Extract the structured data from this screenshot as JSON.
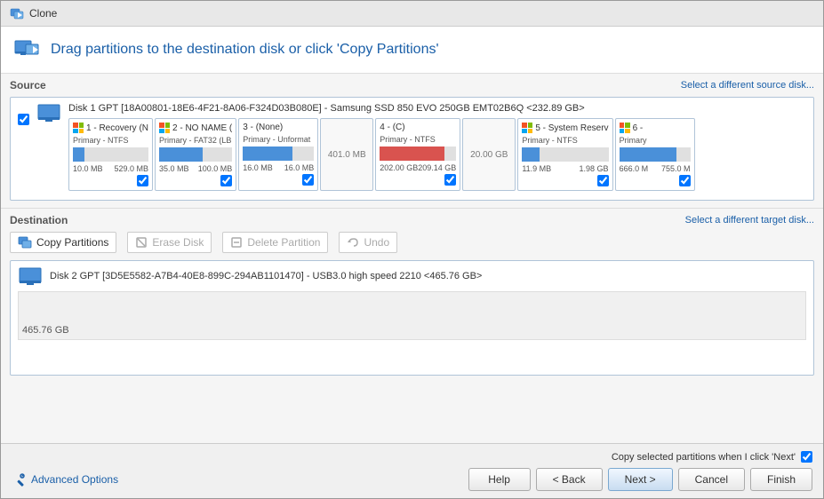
{
  "window": {
    "title": "Clone"
  },
  "instruction": {
    "text": "Drag partitions to the destination disk or click 'Copy Partitions'"
  },
  "source": {
    "label": "Source",
    "link": "Select a different source disk...",
    "disk_title": "Disk 1 GPT [18A00801-18E6-4F21-8A06-F324D03B080E] - Samsung SSD 850 EVO 250GB EMT02B6Q  <232.89 GB>",
    "partitions": [
      {
        "id": 1,
        "name": "1 - Recovery (N",
        "type": "Primary - NTFS",
        "bar_pct": 15,
        "bar_color": "blue",
        "size1": "10.0 MB",
        "size2": "529.0 MB",
        "checked": true,
        "has_win_icon": true
      },
      {
        "id": 2,
        "name": "2 - NO NAME (",
        "type": "Primary - FAT32 (LB",
        "bar_pct": 60,
        "bar_color": "blue",
        "size1": "35.0 MB",
        "size2": "100.0 MB",
        "checked": true,
        "has_win_icon": true
      },
      {
        "id": 3,
        "name": "3 - (None)",
        "type": "Primary - Unformat",
        "bar_pct": 70,
        "bar_color": "blue",
        "size1": "16.0 MB",
        "size2": "16.0 MB",
        "checked": true,
        "has_win_icon": false
      },
      {
        "id": 4,
        "name": "401.0 MB",
        "type": "",
        "bar_pct": 0,
        "bar_color": "gray",
        "size1": "",
        "size2": "",
        "checked": false,
        "has_win_icon": false,
        "is_unallocated": true
      },
      {
        "id": 5,
        "name": "4 - (C)",
        "type": "Primary - NTFS",
        "bar_pct": 85,
        "bar_color": "red",
        "size1": "202.00 GB",
        "size2": "209.14 GB",
        "checked": true,
        "has_win_icon": false
      },
      {
        "id": 6,
        "name": "20.00 GB",
        "type": "",
        "bar_pct": 0,
        "bar_color": "gray",
        "size1": "",
        "size2": "",
        "checked": false,
        "has_win_icon": false,
        "is_unallocated": true
      },
      {
        "id": 7,
        "name": "5 - System Reserv",
        "type": "Primary - NTFS",
        "bar_pct": 20,
        "bar_color": "blue",
        "size1": "11.9 MB",
        "size2": "1.98 GB",
        "checked": true,
        "has_win_icon": true
      },
      {
        "id": 8,
        "name": "6 -",
        "type": "Primary",
        "bar_pct": 80,
        "bar_color": "blue",
        "size1": "666.0 M",
        "size2": "755.0 M",
        "checked": true,
        "has_win_icon": true
      }
    ]
  },
  "destination": {
    "label": "Destination",
    "link": "Select a different target disk...",
    "disk_title": "Disk 2 GPT [3D5E5582-A7B4-40E8-899C-294AB1101470] - USB3.0 high speed 2210  <465.76 GB>",
    "size_label": "465.76 GB"
  },
  "toolbar": {
    "copy_partitions": "Copy Partitions",
    "erase_disk": "Erase Disk",
    "delete_partition": "Delete Partition",
    "undo": "Undo"
  },
  "footer": {
    "copy_label": "Copy selected partitions when I click 'Next'",
    "advanced_options": "Advanced Options",
    "btn_help": "Help",
    "btn_back": "< Back",
    "btn_next": "Next >",
    "btn_cancel": "Cancel",
    "btn_finish": "Finish"
  }
}
